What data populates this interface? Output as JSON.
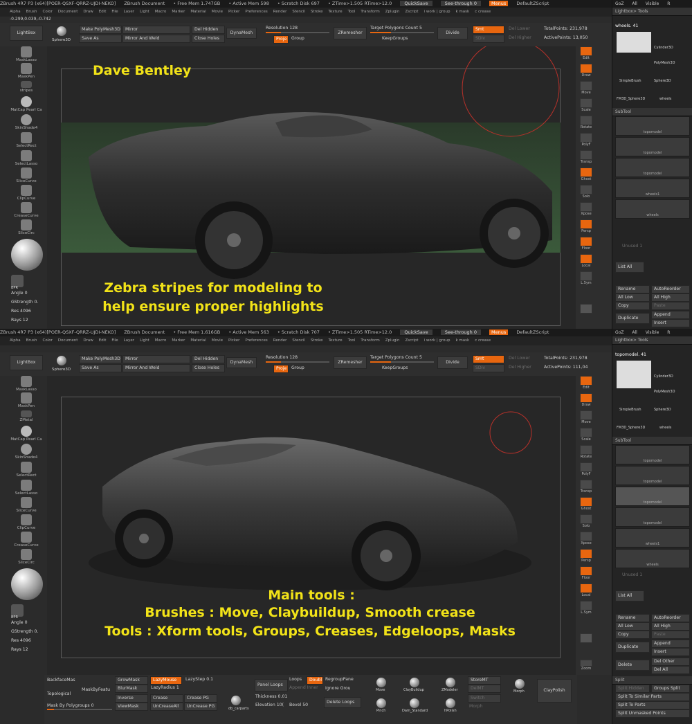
{
  "colors": {
    "accent": "#e8660f",
    "caption": "#f2e318"
  },
  "top_panel": {
    "titlebar": {
      "app": "ZBrush 4R7 P3 (x64)[POER-QSXF-QRRZ-UJDI-NEKO]",
      "doc": "ZBrush Document",
      "free_mem": "• Free Mem 1.747GB",
      "active_mem": "• Active Mem 598",
      "scratch": "• Scratch Disk 697",
      "ztime": "• ZTime>1.505 RTime>12.0",
      "quicksave": "QuickSave",
      "see_through": "See-through 0",
      "menus": "Menus",
      "script": "DefaultZScript"
    },
    "coords": "-0.299,0.039,-0.742",
    "stats": {
      "total_points": "TotalPoints: 231,978",
      "active_points": "ActivePoints: 13,050"
    },
    "caption_name": "Dave Bentley",
    "caption_body_1": "Zebra stripes for modeling to",
    "caption_body_2": "help ensure proper highlights",
    "left_mat": "stripes",
    "tool_current": "wheels. 41",
    "subtools": [
      "topomodel",
      "topomodel",
      "topomodel",
      "wheels1",
      "wheels"
    ]
  },
  "bottom_panel": {
    "titlebar": {
      "app": "ZBrush 4R7 P3 (x64)[POER-QSXF-QRRZ-UJDI-NEKO]",
      "doc": "ZBrush Document",
      "free_mem": "• Free Mem 1.616GB",
      "active_mem": "• Active Mem 563",
      "scratch": "• Scratch Disk 707",
      "ztime": "• ZTime>1.505 RTime>12.0",
      "quicksave": "QuickSave",
      "see_through": "See-through 0",
      "menus": "Menus",
      "script": "DefaultZScript"
    },
    "stats": {
      "total_points": "TotalPoints: 231,978",
      "active_points": "ActivePoints: 111,04"
    },
    "caption_1": "Main tools :",
    "caption_2": "Brushes : Move, Claybuildup, Smooth crease",
    "caption_3": "Tools : Xform tools, Groups, Creases, Edgeloops, Masks",
    "left_mat": "ZMetal",
    "tool_current": "topomodel. 41",
    "subtools": [
      "topomodel",
      "topomodel",
      "topomodel",
      "topomodel",
      "wheels1",
      "wheels"
    ]
  },
  "menu_items": [
    "Alpha",
    "Brush",
    "Color",
    "Document",
    "Draw",
    "Edit",
    "File",
    "Layer",
    "Light",
    "Macro",
    "Marker",
    "Material",
    "Movie",
    "Picker",
    "Preferences",
    "Render",
    "Stencil",
    "Stroke",
    "Texture",
    "Tool",
    "Transform",
    "Zplugin",
    "Zscript",
    "i work | group",
    "k mask",
    "c crease"
  ],
  "top_shelf": {
    "lightbox": "LightBox",
    "sphere3d": "Sphere3D",
    "make_polymesh": "Make PolyMesh3D",
    "save_as": "Save As",
    "mirror": "Mirror",
    "mirror_weld": "Mirror And Weld",
    "del_hidden": "Del Hidden",
    "close_holes": "Close Holes",
    "dynamesh": "DynaMesh",
    "resolution": "Resolution 128",
    "project": "Proje",
    "group": "Group",
    "zremesher": "ZRemesher",
    "target_polygons": "Target Polygons Count 5",
    "keep_groups": "KeepGroups",
    "divide": "Divide",
    "smt": "Smt",
    "suv": "SDiv",
    "del_lower": "Del Lower",
    "del_higher": "Del Higher"
  },
  "left_shelf": [
    "MaskLasso",
    "MaskPen",
    "",
    "MatCap Pearl Ca",
    "SkinShade4",
    "SelectRect",
    "SelectLasso",
    "SliceCurve",
    "ClipCurve",
    "CreaseCurve",
    "SliceCirc"
  ],
  "left_sliders": {
    "angle": "Angle 0",
    "gstrength": "GStrength 0.",
    "res": "Res 4096",
    "rays": "Rays 12",
    "brush_name": "BPR"
  },
  "right_tools": [
    "Edit",
    "Draw",
    "Move",
    "Scale",
    "Rotate",
    "PolyF",
    "Transp",
    "Ghost",
    "Solo",
    "Xpose",
    "Persp",
    "Floor",
    "Local",
    "L.Sym"
  ],
  "right_panel": {
    "goz": "GoZ",
    "all": "All",
    "visible": "Visible",
    "r": "R",
    "lightbox_tools": "Lightbox> Tools",
    "thumbs": [
      "Cylinder3D",
      "PolyMesh3D",
      "SimpleBrush",
      "Sphere3D",
      "FM3D_Sphere3D",
      "wheels"
    ],
    "subtool_header": "SubTool",
    "unused": "Unused 1",
    "list_all": "List All",
    "rename": "Rename",
    "auto_reorder": "AutoReorder",
    "all_low": "All Low",
    "all_high": "All High",
    "copy": "Copy",
    "paste": "Paste",
    "append": "Append",
    "duplicate": "Duplicate",
    "insert": "Insert",
    "delete": "Delete",
    "del_other": "Del Other",
    "del_all": "Del All",
    "split": "Split",
    "split_hidden": "Split Hidden",
    "groups_split": "Groups Split",
    "split_similar": "Split To Similar Parts",
    "split_to_parts": "Split To Parts",
    "split_unmasked": "Split Unmasked Points"
  },
  "bottom_shelf": {
    "backface": "BackfaceMas",
    "topological": "Topological",
    "mask_by_feature": "MaskByFeatu",
    "mask_by_polygroups": "Mask By Polygroups 0",
    "grow_mask": "GrowMask",
    "blur_mask": "BlurMask",
    "inverse": "Inverse",
    "view_mask": "ViewMask",
    "lazy_mouse": "LazyMouse",
    "lazy_step": "LazyStep 0.1",
    "lazy_radius": "LazyRadius 1",
    "crease": "Crease",
    "uncrease_all": "UnCreaseAll",
    "crease_pg": "Crease PG",
    "uncrease_pg": "UnCrease PG",
    "db_carparts": "db_carparts",
    "panel_loops": "Panel Loops",
    "loops": "Loops",
    "double": "Doubl",
    "append_inner": "Append Inner",
    "thickness": "Thickness 0.01",
    "elevation": "Elevation 10(",
    "bevel": "Bevel 50",
    "regroup_panel": "RegroupPane",
    "ignore_groups": "Ignore Grou",
    "delete_loops": "Delete Loops",
    "brush_move": "Move",
    "brush_claybuildup": "ClayBuildup",
    "brush_zmodeler": "ZModeler",
    "brush_pinch": "Pinch",
    "brush_dam": "Dam_Standard",
    "brush_hpolish": "hPolish",
    "store_mt": "StoreMT",
    "del_mt": "DelMT",
    "switch": "Switch",
    "morph_brush": "Morph",
    "morph_slider": "Morph",
    "claypolish": "ClayPolish",
    "zoom": "Zoom"
  }
}
